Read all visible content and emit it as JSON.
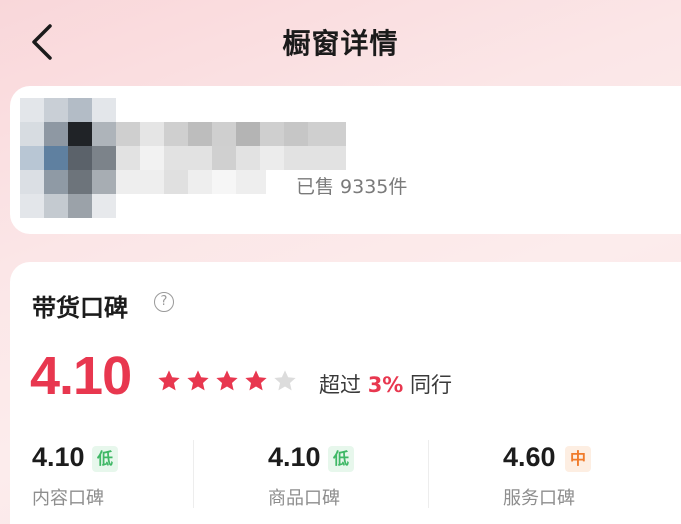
{
  "nav": {
    "title": "橱窗详情",
    "back_icon": "chevron-left-icon"
  },
  "product": {
    "sold_label": "已售 9335件"
  },
  "reputation": {
    "title": "带货口碑",
    "help_icon": "?",
    "score": "4.10",
    "stars": {
      "rating": 4,
      "max": 5,
      "filled_color": "#e8374f",
      "empty_color": "#dcdcdc"
    },
    "beyond_prefix": "超过 ",
    "beyond_percent": "3%",
    "beyond_suffix": " 同行",
    "sub_scores": [
      {
        "value": "4.10",
        "tag": "低",
        "tag_color": "#3fb866",
        "tag_bg": "#e7f7ec",
        "label": "内容口碑"
      },
      {
        "value": "4.10",
        "tag": "低",
        "tag_color": "#3fb866",
        "tag_bg": "#e7f7ec",
        "label": "商品口碑"
      },
      {
        "value": "4.60",
        "tag": "中",
        "tag_color": "#f07b2a",
        "tag_bg": "#fdeee2",
        "label": "服务口碑"
      }
    ]
  },
  "colors": {
    "accent": "#e8374f",
    "background": "#fbe6e7"
  }
}
